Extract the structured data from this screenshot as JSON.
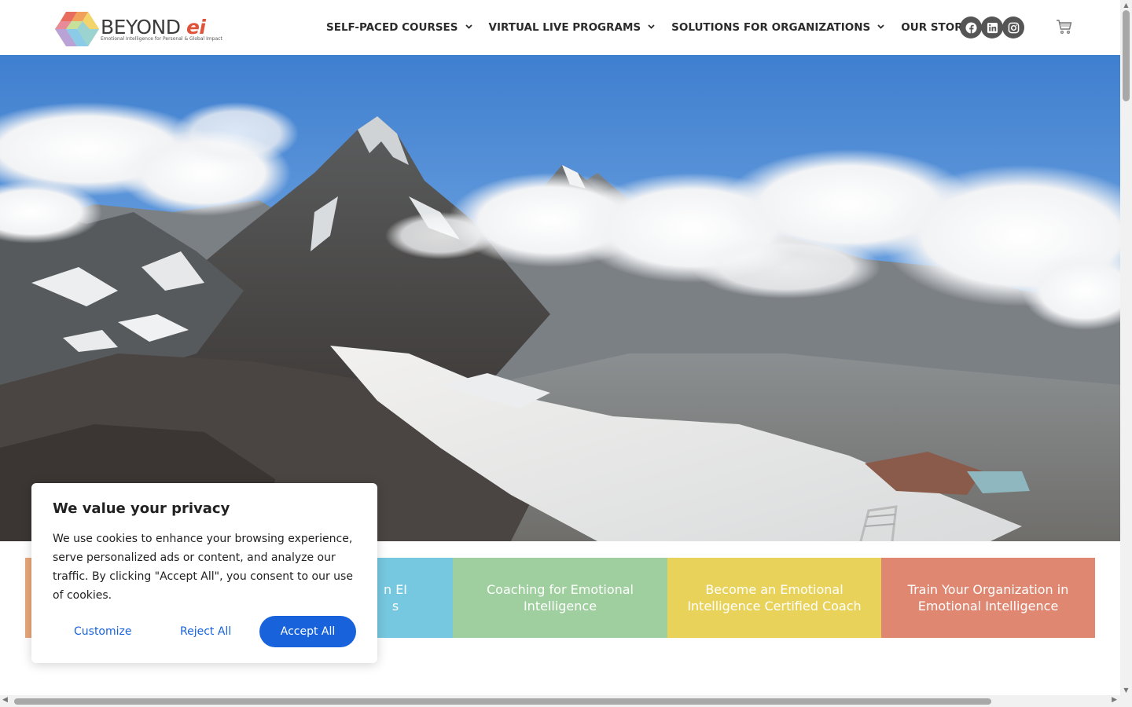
{
  "brand": {
    "name_main": "BEYOND ",
    "name_accent": "ei",
    "tagline": "Emotional Intelligence for Personal & Global Impact"
  },
  "nav": {
    "items": [
      {
        "label": "SELF-PACED COURSES"
      },
      {
        "label": "VIRTUAL LIVE PROGRAMS"
      },
      {
        "label": "SOLUTIONS FOR ORGANIZATIONS"
      },
      {
        "label": "OUR STORY"
      }
    ],
    "more": "···"
  },
  "socials": [
    "facebook-icon",
    "linkedin-icon",
    "instagram-icon"
  ],
  "tiles": [
    {
      "label": "",
      "color": "#e8a77c"
    },
    {
      "label": "n EI\ns",
      "color": "#76c8e0"
    },
    {
      "label": "Coaching for Emotional Intelligence",
      "color": "#9fcf9e"
    },
    {
      "label": "Become an Emotional Intelligence Certified Coach",
      "color": "#e9d25a"
    },
    {
      "label": "Train Your Organization in Emotional Intelligence",
      "color": "#e08772"
    }
  ],
  "cookie": {
    "title": "We value your privacy",
    "body": "We use cookies to enhance your browsing experience, serve personalized ads or content, and analyze our traffic. By clicking \"Accept All\", you consent to our use of cookies.",
    "customize": "Customize",
    "reject": "Reject All",
    "accept": "Accept All",
    "accent_color": "#1863dc"
  }
}
